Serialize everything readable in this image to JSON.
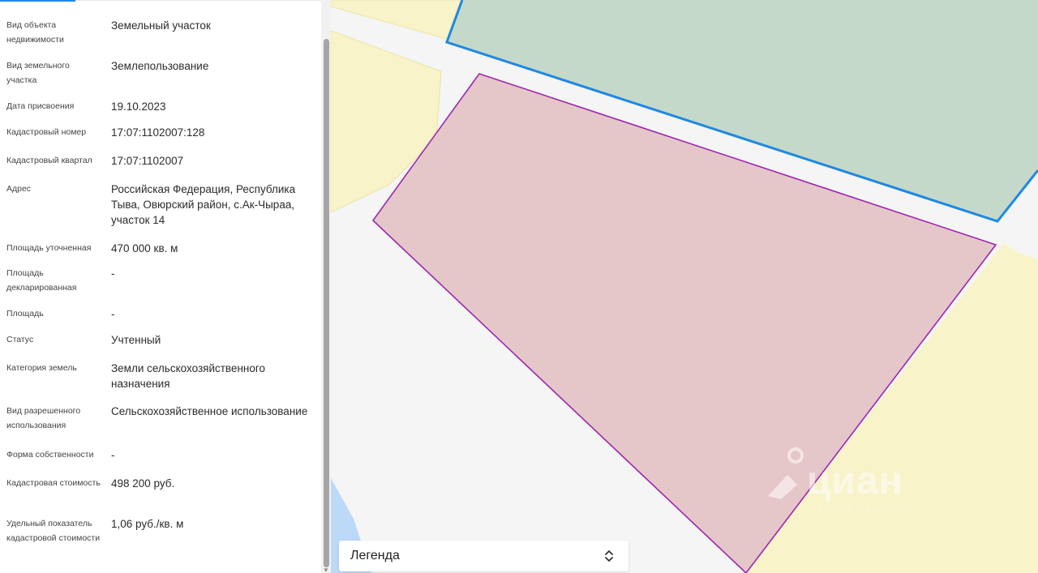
{
  "properties": [
    {
      "label": "Вид объекта недвижимости",
      "value": "Земельный участок"
    },
    {
      "label": "Вид земельного участка",
      "value": "Землепользование"
    },
    {
      "label": "Дата присвоения",
      "value": "19.10.2023"
    },
    {
      "label": "Кадастровый номер",
      "value": "17:07:1102007:128"
    },
    {
      "label": "Кадастровый квартал",
      "value": "17:07:1102007"
    },
    {
      "label": "Адрес",
      "value": "Российская Федерация, Республика Тыва, Овюрский район, с.Ак-Чыраа, участок 14"
    },
    {
      "label": "Площадь уточненная",
      "value": "470 000 кв. м"
    },
    {
      "label": "Площадь декларированная",
      "value": "-"
    },
    {
      "label": "Площадь",
      "value": "-"
    },
    {
      "label": "Статус",
      "value": "Учтенный"
    },
    {
      "label": "Категория земель",
      "value": "Земли сельскохозяйственного назначения"
    },
    {
      "label": "Вид разрешенного использования",
      "value": "Сельскохозяйственное использование"
    },
    {
      "label": "Форма собственности",
      "value": "-"
    },
    {
      "label": "Кадастровая стоимость",
      "value": "498 200 руб."
    },
    {
      "label": "Удельный показатель кадастровой стоимости",
      "value": "1,06 руб./кв. м"
    }
  ],
  "legend": {
    "label": "Легенда",
    "icon": "chevron-updown-icon"
  },
  "watermark": {
    "brand": "циан",
    "icon": "cian-logo-icon"
  },
  "colors": {
    "selected_parcel_fill": "#e5c6c9",
    "selected_parcel_border": "#9c27b0",
    "neighbor_parcel_fill": "#c5d9cb",
    "neighbor_parcel_border": "#1e88e5",
    "farmland_fill": "#f8f3c9",
    "water_fill": "#bcd9f7",
    "map_background": "#f5f5f5"
  }
}
